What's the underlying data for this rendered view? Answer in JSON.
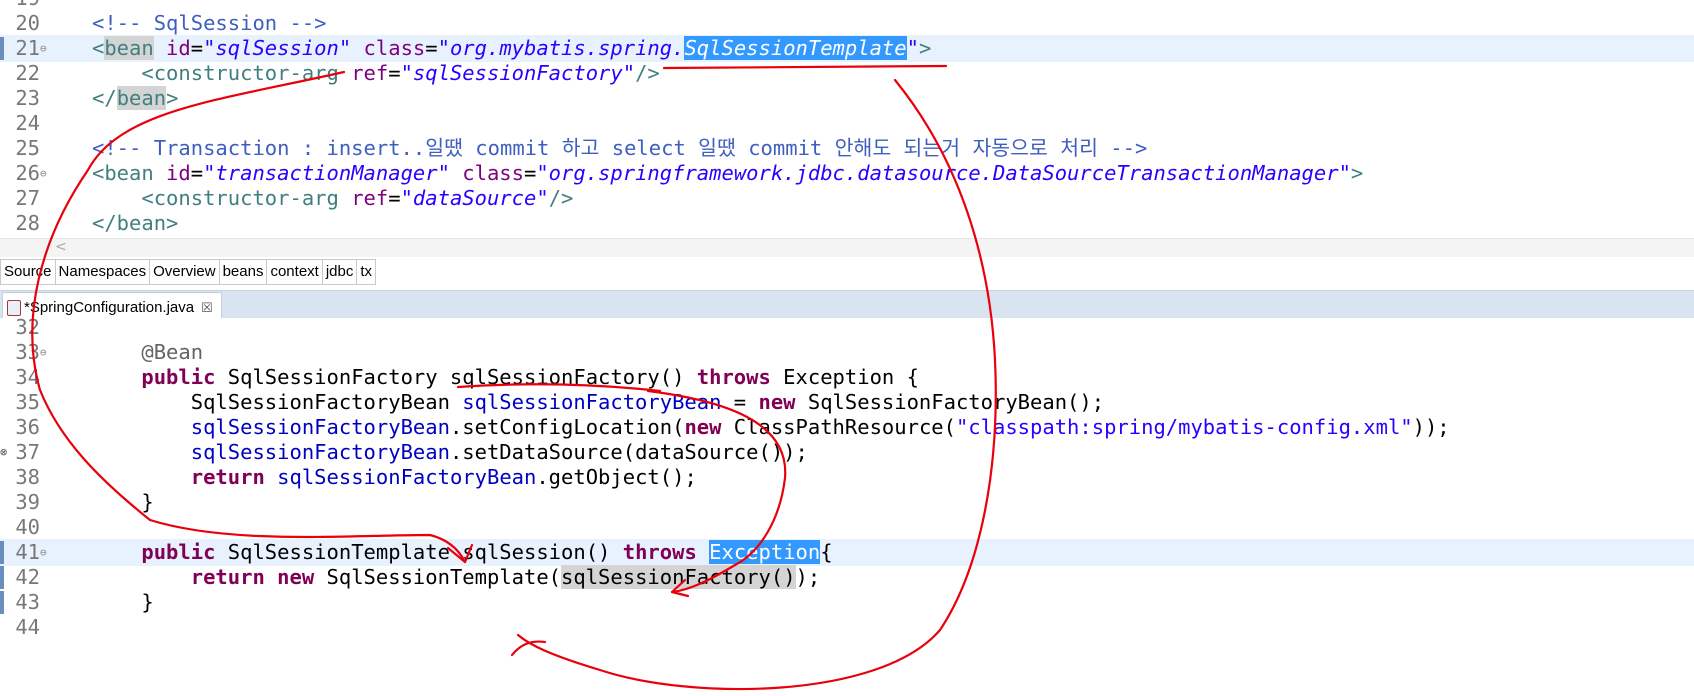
{
  "xml_editor": {
    "lines": [
      {
        "num": "19",
        "partial": true,
        "segments": []
      },
      {
        "num": "20",
        "segments": [
          {
            "t": "<!-- SqlSession -->",
            "c": "cm"
          }
        ]
      },
      {
        "num": "21",
        "fold": "⊖",
        "mark": true,
        "highlight": true,
        "segments": [
          {
            "t": "<",
            "c": "tg"
          },
          {
            "t": "bean",
            "c": "tg occ"
          },
          {
            "t": " id",
            "c": "an"
          },
          {
            "t": "=",
            "c": ""
          },
          {
            "t": "\"sqlSession\"",
            "c": "av"
          },
          {
            "t": " class",
            "c": "an"
          },
          {
            "t": "=",
            "c": ""
          },
          {
            "t": "\"org.mybatis.spring.",
            "c": "av"
          },
          {
            "t": "SqlSessionTemplate",
            "c": "av sel"
          },
          {
            "t": "\"",
            "c": "av"
          },
          {
            "t": ">",
            "c": "tg"
          }
        ]
      },
      {
        "num": "22",
        "segments": [
          {
            "t": "    ",
            "c": ""
          },
          {
            "t": "<constructor-arg",
            "c": "tg"
          },
          {
            "t": " ref",
            "c": "an"
          },
          {
            "t": "=",
            "c": ""
          },
          {
            "t": "\"sqlSessionFactory\"",
            "c": "av"
          },
          {
            "t": "/>",
            "c": "tg"
          }
        ]
      },
      {
        "num": "23",
        "segments": [
          {
            "t": "</",
            "c": "tg"
          },
          {
            "t": "bean",
            "c": "tg occ"
          },
          {
            "t": ">",
            "c": "tg"
          }
        ]
      },
      {
        "num": "24",
        "segments": []
      },
      {
        "num": "25",
        "segments": [
          {
            "t": "<!-- Transaction : insert..일땠 commit 하고 select 일땠 commit 안해도 되는거 자동으로 처리 -->",
            "c": "cm"
          }
        ]
      },
      {
        "num": "26",
        "fold": "⊖",
        "segments": [
          {
            "t": "<bean",
            "c": "tg"
          },
          {
            "t": " id",
            "c": "an"
          },
          {
            "t": "=",
            "c": ""
          },
          {
            "t": "\"transactionManager\"",
            "c": "av"
          },
          {
            "t": " class",
            "c": "an"
          },
          {
            "t": "=",
            "c": ""
          },
          {
            "t": "\"org.springframework.jdbc.datasource.DataSourceTransactionManager\"",
            "c": "av"
          },
          {
            "t": ">",
            "c": "tg"
          }
        ]
      },
      {
        "num": "27",
        "segments": [
          {
            "t": "    ",
            "c": ""
          },
          {
            "t": "<constructor-arg",
            "c": "tg"
          },
          {
            "t": " ref",
            "c": "an"
          },
          {
            "t": "=",
            "c": ""
          },
          {
            "t": "\"dataSource\"",
            "c": "av"
          },
          {
            "t": "/>",
            "c": "tg"
          }
        ]
      },
      {
        "num": "28",
        "segments": [
          {
            "t": "</bean>",
            "c": "tg"
          }
        ]
      }
    ],
    "hscroll_arrow": "<",
    "tabs": [
      "Source",
      "Namespaces",
      "Overview",
      "beans",
      "context",
      "jdbc",
      "tx"
    ]
  },
  "java_editor": {
    "tab_title": "*SpringConfiguration.java",
    "close_glyph": "☒",
    "lines": [
      {
        "num": "32",
        "segments": []
      },
      {
        "num": "33",
        "fold": "⊖",
        "segments": [
          {
            "t": "    ",
            "c": ""
          },
          {
            "t": "@Bean",
            "c": "annot"
          }
        ]
      },
      {
        "num": "34",
        "segments": [
          {
            "t": "    ",
            "c": ""
          },
          {
            "t": "public",
            "c": "kw"
          },
          {
            "t": " SqlSessionFactory sqlSessionFactory() ",
            "c": ""
          },
          {
            "t": "throws",
            "c": "kw"
          },
          {
            "t": " Exception {",
            "c": ""
          }
        ]
      },
      {
        "num": "35",
        "segments": [
          {
            "t": "        SqlSessionFactoryBean ",
            "c": ""
          },
          {
            "t": "sqlSessionFactoryBean",
            "c": "fld"
          },
          {
            "t": " = ",
            "c": ""
          },
          {
            "t": "new",
            "c": "kw"
          },
          {
            "t": " SqlSessionFactoryBean();",
            "c": ""
          }
        ]
      },
      {
        "num": "36",
        "segments": [
          {
            "t": "        ",
            "c": ""
          },
          {
            "t": "sqlSessionFactoryBean",
            "c": "fld"
          },
          {
            "t": ".setConfigLocation(",
            "c": ""
          },
          {
            "t": "new",
            "c": "kw"
          },
          {
            "t": " ClassPathResource(",
            "c": ""
          },
          {
            "t": "\"classpath:spring/mybatis-config.xml\"",
            "c": "str"
          },
          {
            "t": "));",
            "c": ""
          }
        ]
      },
      {
        "num": "37",
        "override": "⊗",
        "segments": [
          {
            "t": "        ",
            "c": ""
          },
          {
            "t": "sqlSessionFactoryBean",
            "c": "fld"
          },
          {
            "t": ".setDataSource(dataSource());",
            "c": ""
          }
        ]
      },
      {
        "num": "38",
        "segments": [
          {
            "t": "        ",
            "c": ""
          },
          {
            "t": "return",
            "c": "kw"
          },
          {
            "t": " ",
            "c": ""
          },
          {
            "t": "sqlSessionFactoryBean",
            "c": "fld"
          },
          {
            "t": ".getObject();",
            "c": ""
          }
        ]
      },
      {
        "num": "39",
        "segments": [
          {
            "t": "    }",
            "c": ""
          }
        ]
      },
      {
        "num": "40",
        "segments": []
      },
      {
        "num": "41",
        "fold": "⊖",
        "mark": true,
        "highlight": true,
        "segments": [
          {
            "t": "    ",
            "c": ""
          },
          {
            "t": "public",
            "c": "kw"
          },
          {
            "t": " SqlSessionTemplate sqlSession() ",
            "c": ""
          },
          {
            "t": "throws",
            "c": "kw"
          },
          {
            "t": " ",
            "c": ""
          },
          {
            "t": "Exception",
            "c": "sel"
          },
          {
            "t": "{",
            "c": ""
          }
        ]
      },
      {
        "num": "42",
        "mark": true,
        "segments": [
          {
            "t": "        ",
            "c": ""
          },
          {
            "t": "return",
            "c": "kw"
          },
          {
            "t": " ",
            "c": ""
          },
          {
            "t": "new",
            "c": "kw"
          },
          {
            "t": " SqlSessionTemplate(",
            "c": ""
          },
          {
            "t": "sqlSessionFactory()",
            "c": "occ"
          },
          {
            "t": ");",
            "c": ""
          }
        ]
      },
      {
        "num": "43",
        "mark": true,
        "segments": [
          {
            "t": "    }",
            "c": ""
          }
        ]
      },
      {
        "num": "44",
        "segments": []
      }
    ]
  },
  "annotation_color": "#e8000b"
}
